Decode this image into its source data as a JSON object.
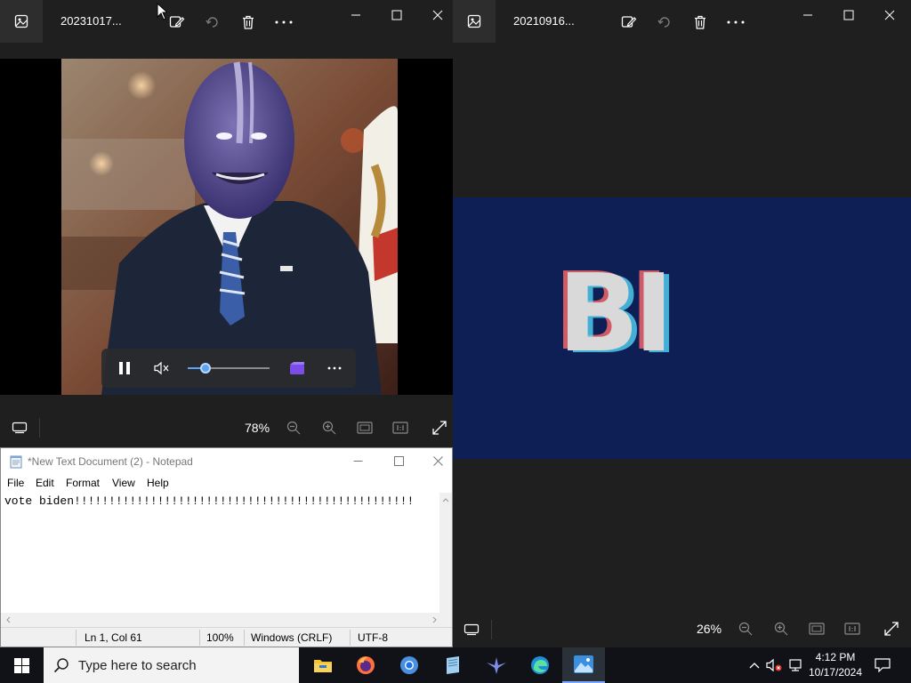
{
  "left_photos": {
    "filename": "20231017...",
    "zoom": "78%"
  },
  "right_photos": {
    "filename": "20210916...",
    "zoom": "26%",
    "image_text": "BI"
  },
  "video_controls": {
    "volume_level": 0.22
  },
  "notepad": {
    "title": "*New Text Document (2) - Notepad",
    "menu": [
      "File",
      "Edit",
      "Format",
      "View",
      "Help"
    ],
    "content": "vote biden!!!!!!!!!!!!!!!!!!!!!!!!!!!!!!!!!!!!!!!!!!!!!!!!!",
    "status": {
      "position": "Ln 1, Col 61",
      "zoom": "100%",
      "line_ending": "Windows (CRLF)",
      "encoding": "UTF-8"
    }
  },
  "taskbar": {
    "search_placeholder": "Type here to search",
    "apps": [
      "file-explorer",
      "firefox",
      "chrome",
      "notepad",
      "photos-video",
      "edge",
      "photos"
    ],
    "time": "4:12 PM",
    "date": "10/17/2024"
  },
  "colors": {
    "photos_bg": "#1f1f1f",
    "right_banner": "#0e1f55",
    "accent": "#5ba4f5"
  }
}
